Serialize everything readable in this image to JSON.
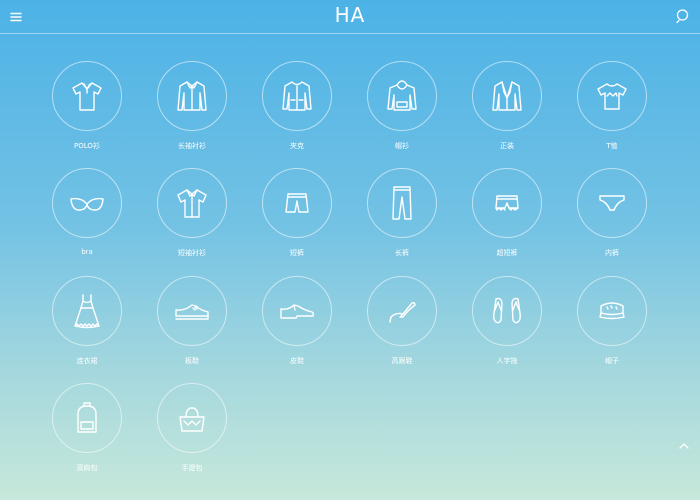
{
  "header": {
    "logo": "HA",
    "menu_icon": "hamburger-icon",
    "search_icon": "search-icon"
  },
  "categories": [
    {
      "label": "POLO衫",
      "icon": "polo-shirt-icon"
    },
    {
      "label": "长袖衬衫",
      "icon": "long-sleeve-shirt-icon"
    },
    {
      "label": "夹克",
      "icon": "jacket-icon"
    },
    {
      "label": "帽衫",
      "icon": "hoodie-icon"
    },
    {
      "label": "正装",
      "icon": "suit-icon"
    },
    {
      "label": "T恤",
      "icon": "t-shirt-icon"
    },
    {
      "label": "bra",
      "icon": "bra-icon"
    },
    {
      "label": "短袖衬衫",
      "icon": "short-sleeve-shirt-icon"
    },
    {
      "label": "短裤",
      "icon": "shorts-icon"
    },
    {
      "label": "长裤",
      "icon": "trousers-icon"
    },
    {
      "label": "超短裤",
      "icon": "hot-pants-icon"
    },
    {
      "label": "内裤",
      "icon": "underwear-icon"
    },
    {
      "label": "连衣裙",
      "icon": "dress-icon"
    },
    {
      "label": "板鞋",
      "icon": "sneaker-icon"
    },
    {
      "label": "皮鞋",
      "icon": "leather-shoe-icon"
    },
    {
      "label": "高跟鞋",
      "icon": "high-heel-icon"
    },
    {
      "label": "人字拖",
      "icon": "flip-flops-icon"
    },
    {
      "label": "帽子",
      "icon": "cap-icon"
    },
    {
      "label": "双肩包",
      "icon": "backpack-icon"
    },
    {
      "label": "手提包",
      "icon": "handbag-icon"
    }
  ],
  "scroll_top_icon": "chevron-up-icon",
  "colors": {
    "bg_top": "#4cb2e6",
    "bg_bottom": "#c7e8da",
    "foreground": "#ffffff"
  }
}
